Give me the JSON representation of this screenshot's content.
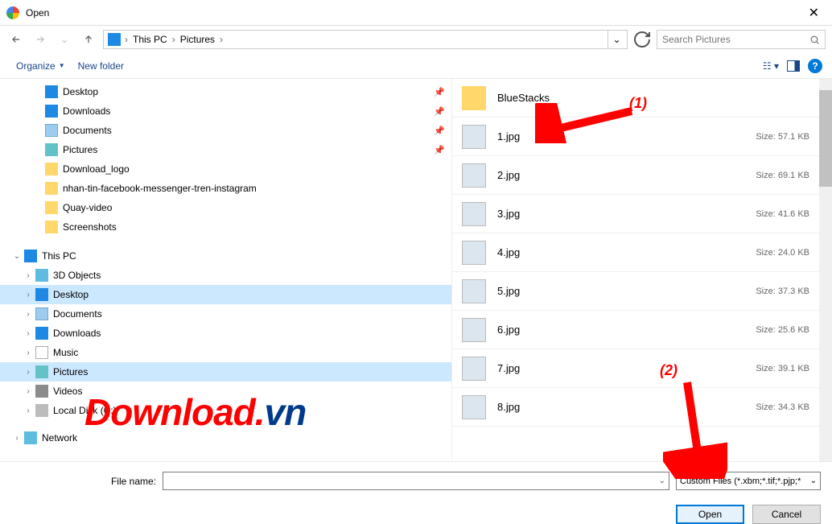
{
  "title": "Open",
  "breadcrumb": {
    "root": "This PC",
    "folder": "Pictures"
  },
  "search": {
    "placeholder": "Search Pictures"
  },
  "toolbar": {
    "organize": "Organize",
    "newfolder": "New folder"
  },
  "tree": {
    "quick": [
      {
        "label": "Desktop",
        "ico": "ico-desktop",
        "pad": 40,
        "pin": true
      },
      {
        "label": "Downloads",
        "ico": "ico-downloads",
        "pad": 40,
        "pin": true
      },
      {
        "label": "Documents",
        "ico": "ico-docs",
        "pad": 40,
        "pin": true
      },
      {
        "label": "Pictures",
        "ico": "ico-pics",
        "pad": 40,
        "pin": true
      },
      {
        "label": "Download_logo",
        "ico": "ico-folder",
        "pad": 40
      },
      {
        "label": "nhan-tin-facebook-messenger-tren-instagram",
        "ico": "ico-folder",
        "pad": 40
      },
      {
        "label": "Quay-video",
        "ico": "ico-folder",
        "pad": 40
      },
      {
        "label": "Screenshots",
        "ico": "ico-folder",
        "pad": 40
      }
    ],
    "thispc": {
      "label": "This PC"
    },
    "pc_children": [
      {
        "label": "3D Objects",
        "ico": "ico-3d"
      },
      {
        "label": "Desktop",
        "ico": "ico-desktop",
        "sel": true
      },
      {
        "label": "Documents",
        "ico": "ico-docs"
      },
      {
        "label": "Downloads",
        "ico": "ico-downloads"
      },
      {
        "label": "Music",
        "ico": "ico-music"
      },
      {
        "label": "Pictures",
        "ico": "ico-pics",
        "sel": true
      },
      {
        "label": "Videos",
        "ico": "ico-videos"
      },
      {
        "label": "Local Disk (C:)",
        "ico": "ico-disk"
      }
    ],
    "network": {
      "label": "Network"
    }
  },
  "files": [
    {
      "name": "BlueStacks",
      "folder": true
    },
    {
      "name": "1.jpg",
      "size": "Size: 57.1 KB"
    },
    {
      "name": "2.jpg",
      "size": "Size: 69.1 KB"
    },
    {
      "name": "3.jpg",
      "size": "Size: 41.6 KB"
    },
    {
      "name": "4.jpg",
      "size": "Size: 24.0 KB"
    },
    {
      "name": "5.jpg",
      "size": "Size: 37.3 KB"
    },
    {
      "name": "6.jpg",
      "size": "Size: 25.6 KB"
    },
    {
      "name": "7.jpg",
      "size": "Size: 39.1 KB"
    },
    {
      "name": "8.jpg",
      "size": "Size: 34.3 KB"
    }
  ],
  "footer": {
    "fname_label": "File name:",
    "filter": "Custom Files (*.xbm;*.tif;*.pjp;*",
    "open": "Open",
    "cancel": "Cancel"
  },
  "anno": {
    "a1": "(1)",
    "a2": "(2)"
  },
  "watermark": {
    "t1": "Download",
    "dot": ".",
    "t2": "vn"
  }
}
